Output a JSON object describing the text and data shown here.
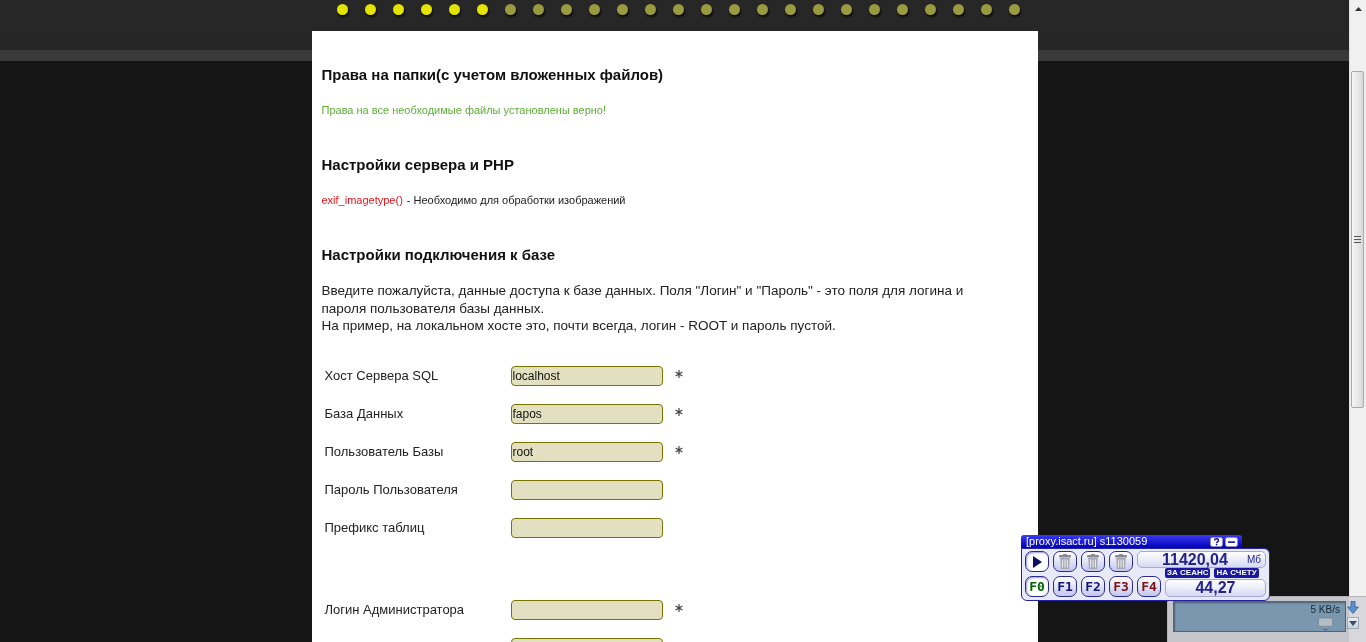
{
  "progress_dots": [
    {
      "on": true
    },
    {
      "on": true
    },
    {
      "on": true
    },
    {
      "on": true
    },
    {
      "on": true
    },
    {
      "on": true
    },
    {
      "on": false
    },
    {
      "on": false
    },
    {
      "on": false
    },
    {
      "on": false
    },
    {
      "on": false
    },
    {
      "on": false
    },
    {
      "on": false
    },
    {
      "on": false
    },
    {
      "on": false
    },
    {
      "on": false
    },
    {
      "on": false
    },
    {
      "on": false
    },
    {
      "on": false
    },
    {
      "on": false
    },
    {
      "on": false
    },
    {
      "on": false
    },
    {
      "on": false
    },
    {
      "on": false
    },
    {
      "on": false
    }
  ],
  "sections": [
    {
      "heading": "Права на папки(с учетом вложенных файлов)",
      "messages": [
        {
          "kind": "success",
          "text": "Права на все необходимые файлы установлены верно!"
        }
      ]
    },
    {
      "heading": "Настройки сервера и PHP",
      "messages": [
        {
          "kind": "missing",
          "function": "exif_imagetype()",
          "text": "- Необходимо для обработки изображений"
        }
      ]
    },
    {
      "heading": "Настройки подключения к базе",
      "paragraphs": [
        "Введите пожалуйста, данные доступа к базе данных. Поля \"Логин\" и \"Пароль\" - это поля для логина и пароля пользователя базы данных.",
        "На пример, на локальном хосте это, почти всегда, логин - ROOT и пароль пустой."
      ],
      "field_groups": [
        {
          "fields": [
            {
              "label": "Хост Сервера SQL",
              "value": "localhost",
              "required": true
            },
            {
              "label": "База Данных",
              "value": "fapos",
              "required": true
            },
            {
              "label": "Пользователь Базы",
              "value": "root",
              "required": true
            },
            {
              "label": "Пароль Пользователя",
              "required": false
            },
            {
              "label": "Префикс таблиц",
              "required": false
            }
          ]
        },
        {
          "fields": [
            {
              "label": "Логин Администратора",
              "required": true
            },
            {
              "required": false
            }
          ]
        }
      ]
    }
  ],
  "proxy_widget": {
    "title": "[proxy.isact.ru] s1130059",
    "tool_buttons": [
      {
        "kind": "play"
      },
      {
        "kind": "trash"
      },
      {
        "kind": "trash"
      },
      {
        "kind": "trash"
      }
    ],
    "traffic": "11420,04",
    "traffic_unit": "Мб",
    "session_label": "ЗА СЕАНС",
    "balance_label": "НА СЧЕТУ",
    "balance": "44,27",
    "profiles": [
      {
        "label": "F0",
        "selected": true,
        "color": "#006400"
      },
      {
        "label": "F1",
        "selected": false,
        "color": "#14147a"
      },
      {
        "label": "F2",
        "selected": false,
        "color": "#14147a"
      },
      {
        "label": "F3",
        "selected": false,
        "color": "#7a1414"
      },
      {
        "label": "F4",
        "selected": false,
        "color": "#7a1414"
      }
    ]
  },
  "net_meter": {
    "speed": "5 KB/s"
  }
}
